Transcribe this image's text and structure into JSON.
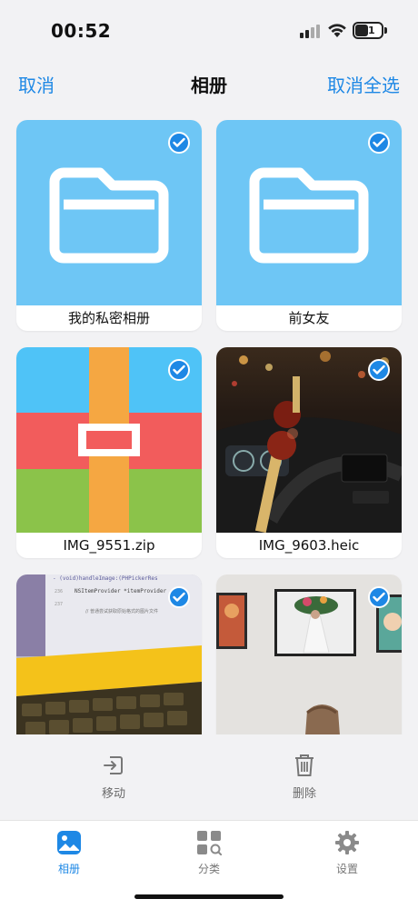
{
  "status": {
    "time": "00:52",
    "battery": "41"
  },
  "nav": {
    "left": "取消",
    "title": "相册",
    "right": "取消全选"
  },
  "items": [
    {
      "name": "我的私密相册",
      "kind": "folder",
      "selected": true
    },
    {
      "name": "前女友",
      "kind": "folder",
      "selected": true
    },
    {
      "name": "IMG_9551.zip",
      "kind": "zip",
      "selected": true
    },
    {
      "name": "IMG_9603.heic",
      "kind": "photo",
      "selected": true
    },
    {
      "name": "",
      "kind": "photo",
      "selected": true
    },
    {
      "name": "",
      "kind": "photo",
      "selected": true
    }
  ],
  "code_snippet": {
    "line1": "- (void)handleImage:(PHPickerRes",
    "line2": "NSItemProvider *itemProvider",
    "line3": "// 普通尝试获取原始格式的图片文件",
    "ln1": "236",
    "ln2": "237"
  },
  "actions": {
    "move": "移动",
    "delete": "删除"
  },
  "tabs": {
    "album": "相册",
    "category": "分类",
    "settings": "设置"
  },
  "colors": {
    "accent": "#1e88e5",
    "folder_bg": "#6ec6f5"
  }
}
